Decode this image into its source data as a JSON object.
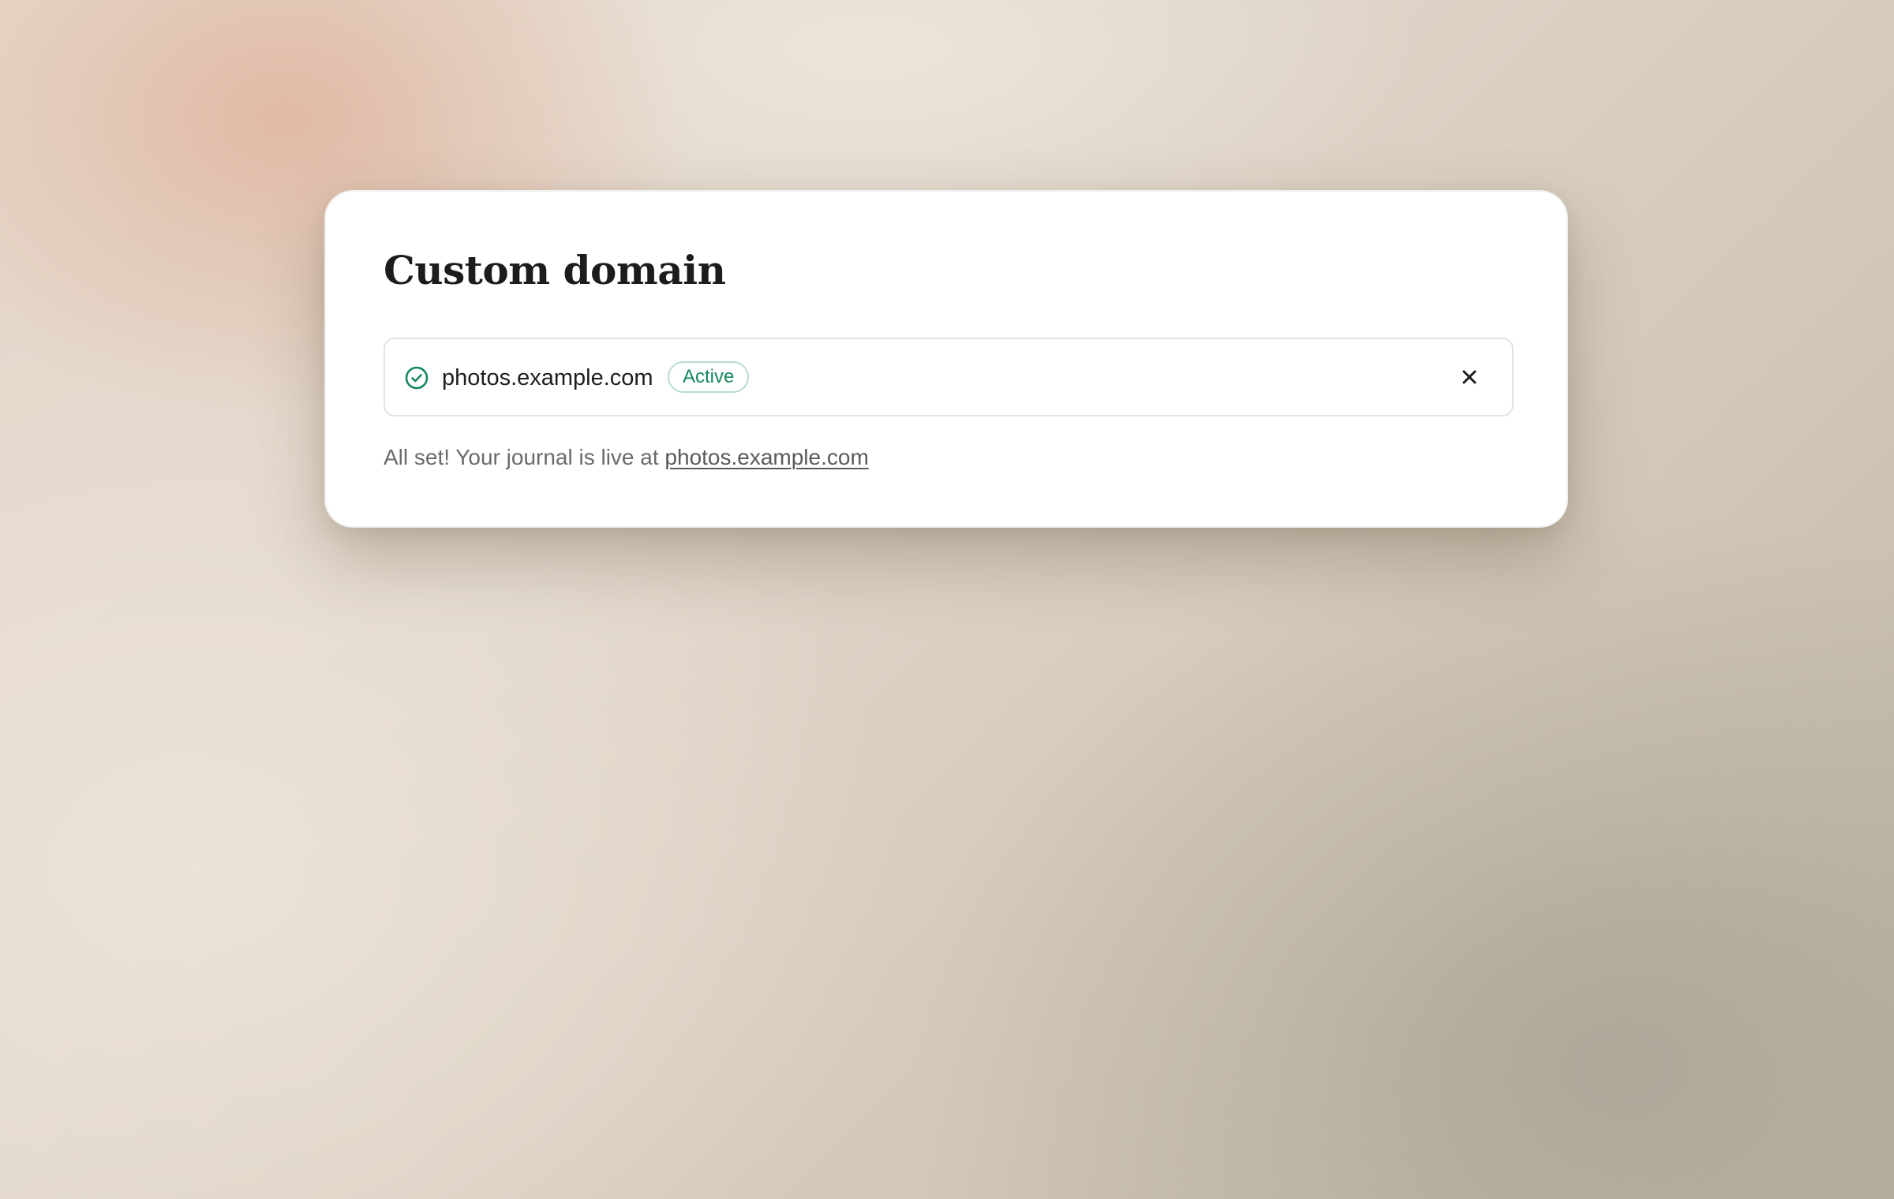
{
  "dialog": {
    "title": "Custom domain",
    "domain": {
      "name": "photos.example.com",
      "status_label": "Active",
      "status_icon": "check-circle-icon",
      "remove_icon": "close-icon"
    },
    "message": {
      "prefix": "All set! Your journal is live at ",
      "link_text": "photos.example.com"
    }
  },
  "colors": {
    "accent_green": "#14895a",
    "badge_border": "#b9dccb",
    "title_text": "#1c1c1c",
    "muted_text": "#6a6a6a"
  }
}
